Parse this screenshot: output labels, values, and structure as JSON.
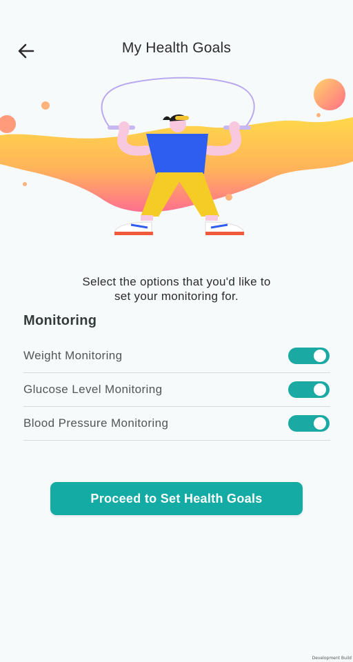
{
  "header": {
    "title": "My Health Goals",
    "back_icon": "arrow-left-icon"
  },
  "intro": {
    "line1": "Select the options that you'd like to",
    "line2": "set your monitoring for."
  },
  "monitoring": {
    "title": "Monitoring",
    "items": [
      {
        "label": "Weight Monitoring",
        "enabled": true
      },
      {
        "label": "Glucose Level Monitoring",
        "enabled": true
      },
      {
        "label": "Blood Pressure Monitoring",
        "enabled": true
      }
    ]
  },
  "cta": {
    "label": "Proceed to Set Health Goals"
  },
  "build_tag": "Development Build",
  "colors": {
    "accent": "#15aba5",
    "toggle_on": "#1ba9a4",
    "background": "#f7fafb"
  }
}
